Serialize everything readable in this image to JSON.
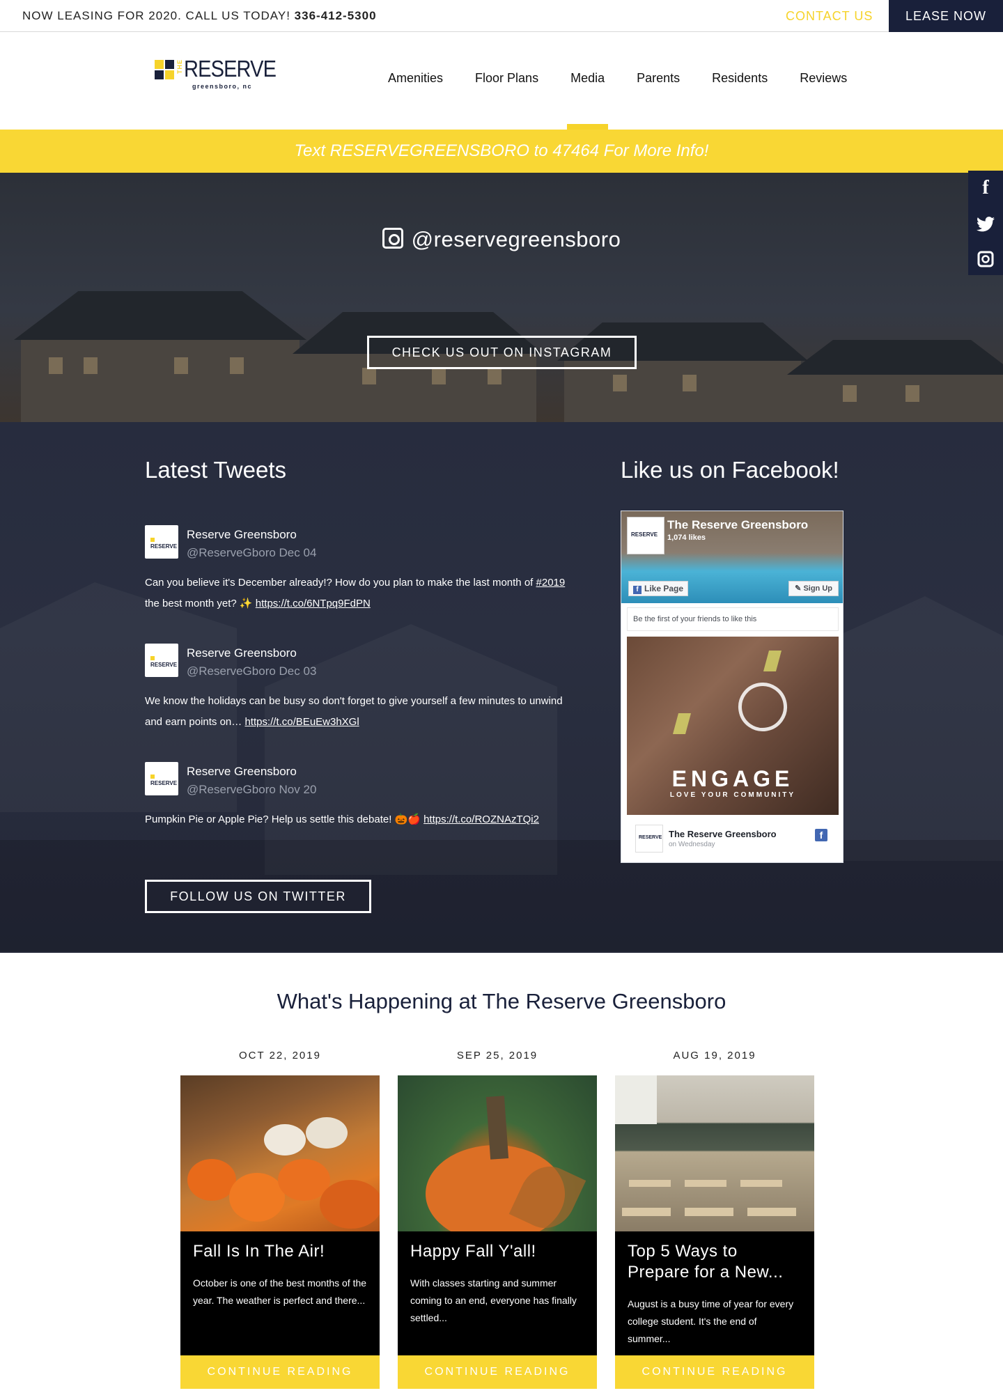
{
  "topbar": {
    "leasing_text": "NOW LEASING FOR 2020. CALL US TODAY!",
    "phone": "336-412-5300",
    "contact_label": "CONTACT US",
    "lease_label": "LEASE NOW"
  },
  "logo": {
    "the": "THE",
    "name": "RESERVE",
    "location": "greensboro, nc"
  },
  "nav": {
    "items": [
      {
        "label": "Amenities"
      },
      {
        "label": "Floor Plans"
      },
      {
        "label": "Media"
      },
      {
        "label": "Parents"
      },
      {
        "label": "Residents"
      },
      {
        "label": "Reviews"
      }
    ]
  },
  "banner": {
    "text": "Text RESERVEGREENSBORO to 47464 For More Info!"
  },
  "instagram": {
    "handle": "@reservegreensboro",
    "button_label": "CHECK US OUT ON INSTAGRAM"
  },
  "social_tabs": {
    "facebook": "f",
    "twitter": "t",
    "instagram": "ig"
  },
  "tweets_section": {
    "title": "Latest Tweets",
    "tweets": [
      {
        "name": "Reserve Greensboro",
        "meta": "@ReserveGboro Dec 04",
        "text": "Can you believe it's December already!? How do you plan to make the last month of",
        "hashtag": "#2019",
        "text2": "the best month yet? ✨",
        "link": "https://t.co/6NTpq9FdPN"
      },
      {
        "name": "Reserve Greensboro",
        "meta": "@ReserveGboro Dec 03",
        "text": "We know the holidays can be busy so don't forget to give yourself a few minutes to unwind and earn points on…",
        "link": "https://t.co/BEuEw3hXGl"
      },
      {
        "name": "Reserve Greensboro",
        "meta": "@ReserveGboro Nov 20",
        "text": "Pumpkin Pie or Apple Pie? Help us settle this debate! 🎃🍎",
        "link": "https://t.co/ROZNAzTQi2"
      }
    ],
    "avatar_text": "RESERVE",
    "follow_label": "FOLLOW US ON TWITTER"
  },
  "facebook_section": {
    "title": "Like us on Facebook!",
    "page_name": "The Reserve Greensboro",
    "likes": "1,074 likes",
    "like_label": "Like Page",
    "signup_label": "Sign Up",
    "first_friends": "Be the first of your friends to like this",
    "post_headline": "ENGAGE",
    "post_tagline": "LOVE YOUR COMMUNITY",
    "post_author": "The Reserve Greensboro",
    "post_when": "on Wednesday",
    "logo_text": "RESERVE"
  },
  "happening": {
    "title": "What's Happening at The Reserve Greensboro",
    "cards": [
      {
        "date": "OCT 22, 2019",
        "title": "Fall Is In The Air!",
        "excerpt": "October is one of the best months of the year. The weather is perfect and there...",
        "more": "CONTINUE READING"
      },
      {
        "date": "SEP 25, 2019",
        "title": "Happy Fall Y'all!",
        "excerpt": "With classes starting and summer coming to an end, everyone has finally settled...",
        "more": "CONTINUE READING"
      },
      {
        "date": "AUG 19, 2019",
        "title": "Top 5 Ways to Prepare for a New...",
        "excerpt": "August is a busy time of year for every college student. It's the end of summer...",
        "more": "CONTINUE READING"
      }
    ]
  },
  "colors": {
    "navy": "#19203a",
    "yellow": "#f9d734",
    "accent_text": "#f6d32a"
  }
}
